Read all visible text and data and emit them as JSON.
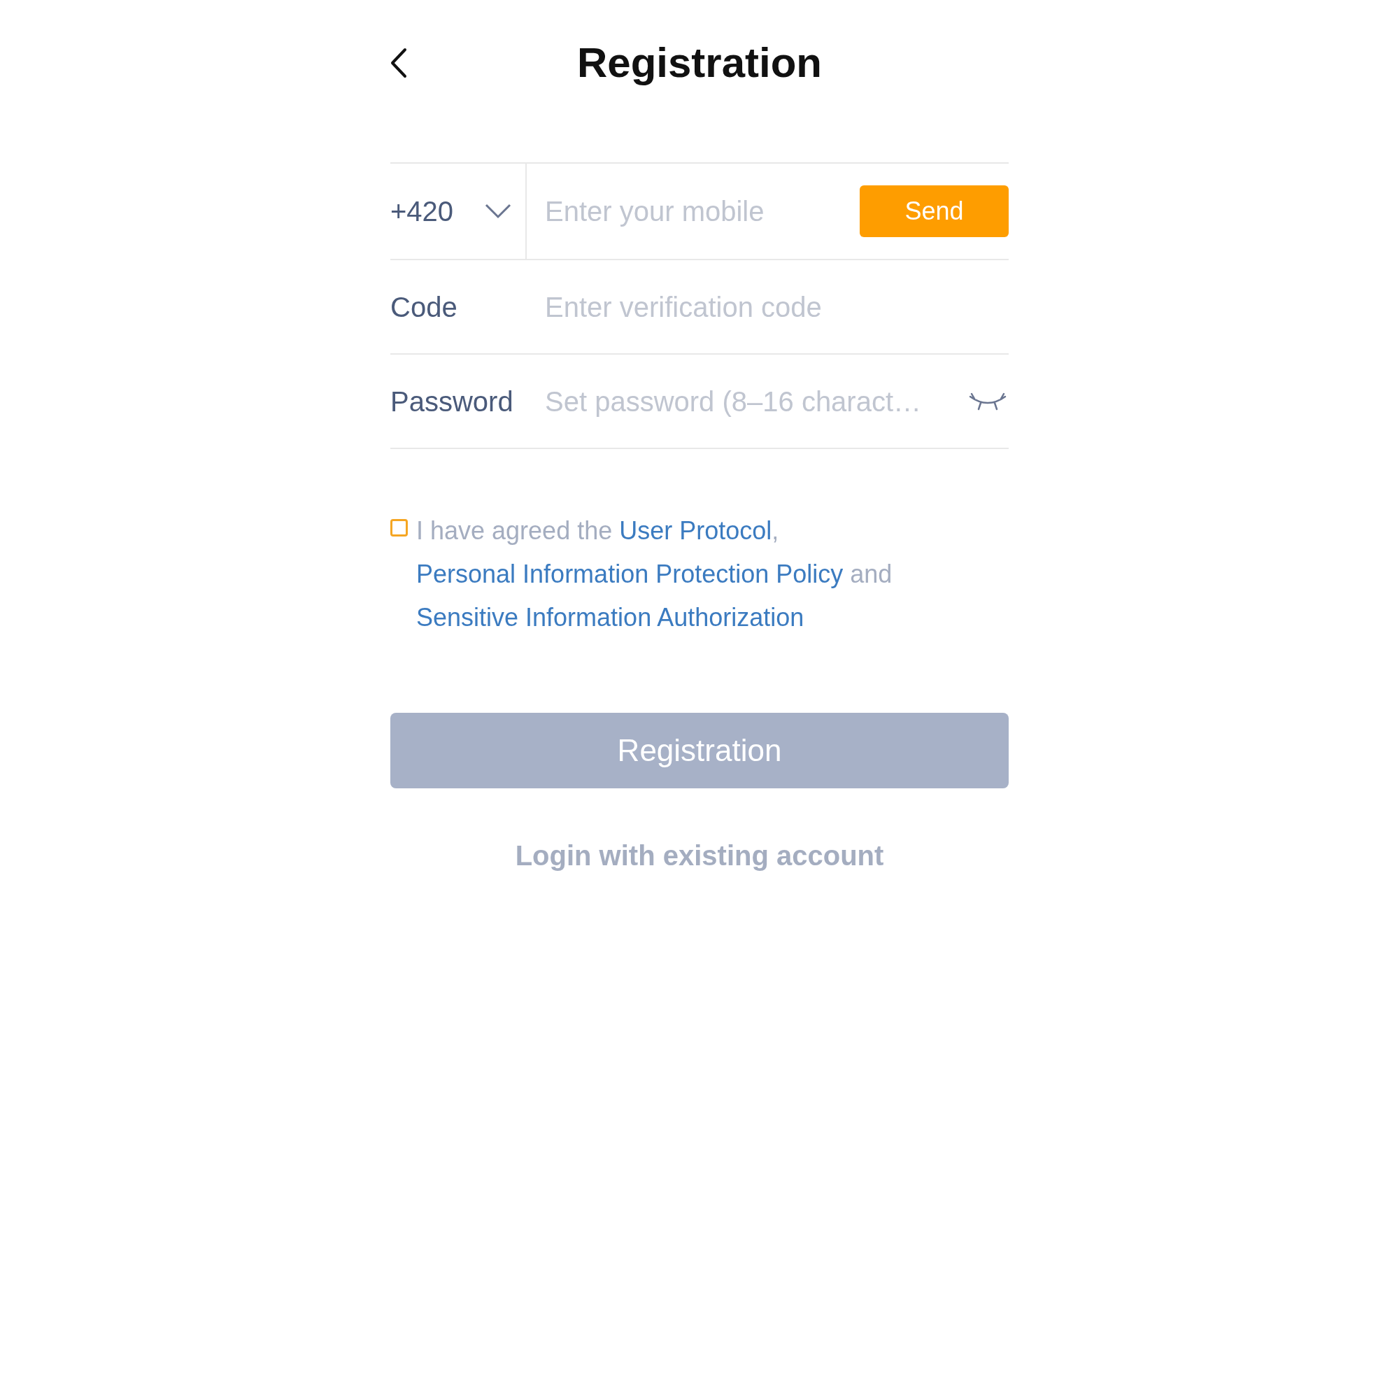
{
  "header": {
    "title": "Registration"
  },
  "phone": {
    "country_code": "+420",
    "placeholder": "Enter your mobile",
    "send_button": "Send"
  },
  "code": {
    "label": "Code",
    "placeholder": "Enter verification code"
  },
  "password": {
    "label": "Password",
    "placeholder": "Set password (8–16 charact…",
    "visible": false
  },
  "agreement": {
    "checked": false,
    "segments": [
      {
        "kind": "text",
        "text": "I have agreed the "
      },
      {
        "kind": "link",
        "text": "User Protocol"
      },
      {
        "kind": "text",
        "text": ", "
      },
      {
        "kind": "link",
        "text": "Personal Information Protection Policy"
      },
      {
        "kind": "text",
        "text": " and "
      },
      {
        "kind": "link",
        "text": "Sensitive Information Authorization"
      }
    ]
  },
  "register_button": {
    "label": "Registration",
    "disabled": true
  },
  "login_link": "Login with existing account"
}
